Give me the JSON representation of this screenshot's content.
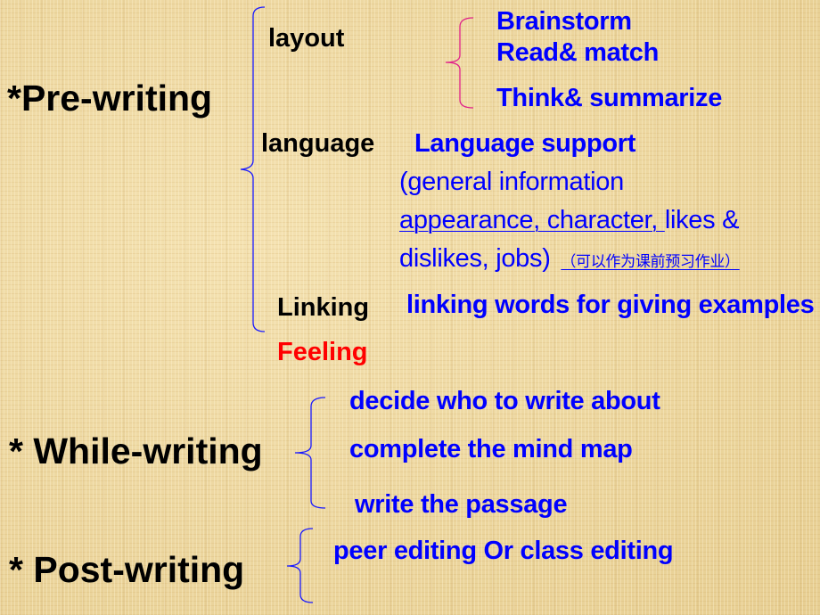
{
  "colors": {
    "heading": "#000000",
    "detail": "#0000ff",
    "highlight": "#ff0000",
    "sub_bracket": "#e0228a",
    "bracket": "#1a1aff"
  },
  "pre_writing": {
    "title": "*Pre-writing",
    "branches": {
      "layout": {
        "label": "layout",
        "items": [
          "Brainstorm",
          "Read& match",
          "Think& summarize"
        ]
      },
      "language": {
        "label": "language",
        "support": "Language support",
        "line1": "(general information",
        "line2_underlined": "appearance, character, ",
        "line2_rest": "likes &",
        "line3": "dislikes, jobs)",
        "note_cn": "（可以作为课前预习作业）"
      },
      "linking": {
        "label": "Linking",
        "detail": "linking words for giving examples"
      },
      "feeling": {
        "label": "Feeling"
      }
    }
  },
  "while_writing": {
    "title": "* While-writing",
    "items": [
      "decide who to write about",
      "complete the mind map",
      "write the passage"
    ]
  },
  "post_writing": {
    "title": "* Post-writing",
    "items": [
      "peer editing Or class editing"
    ]
  }
}
